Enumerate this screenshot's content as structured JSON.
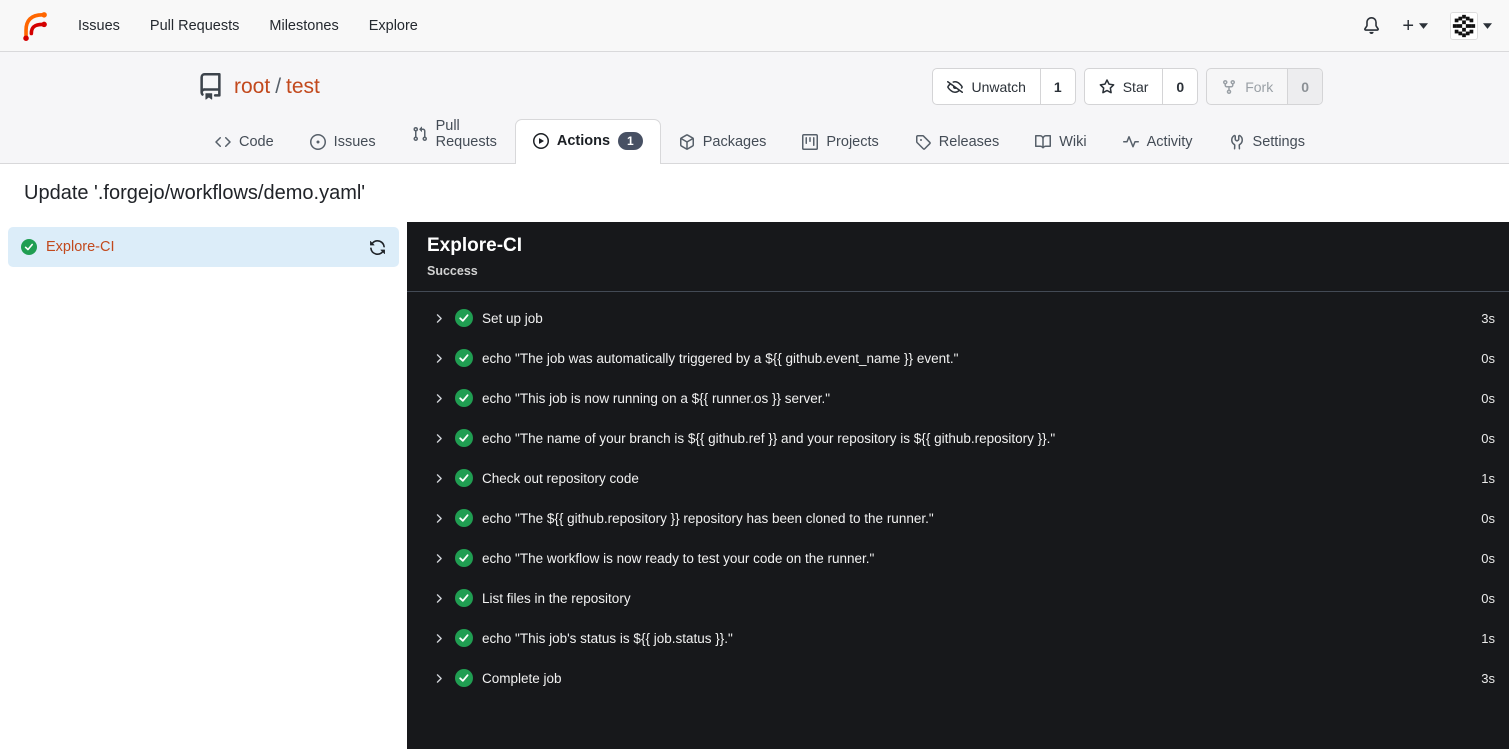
{
  "navbar": {
    "items": [
      {
        "label": "Issues"
      },
      {
        "label": "Pull Requests"
      },
      {
        "label": "Milestones"
      },
      {
        "label": "Explore"
      }
    ],
    "icons": {
      "bell": "notifications",
      "plus": "+",
      "avatar": "user-identicon"
    }
  },
  "repo": {
    "owner": "root",
    "separator": "/",
    "name": "test",
    "actions": [
      {
        "label": "Unwatch",
        "count": "1"
      },
      {
        "label": "Star",
        "count": "0"
      },
      {
        "label": "Fork",
        "count": "0"
      }
    ],
    "tabs": [
      {
        "label": "Code"
      },
      {
        "label": "Issues"
      },
      {
        "label": "Pull Requests"
      },
      {
        "label": "Actions",
        "badge": "1"
      },
      {
        "label": "Packages"
      },
      {
        "label": "Projects"
      },
      {
        "label": "Releases"
      },
      {
        "label": "Wiki"
      },
      {
        "label": "Activity"
      },
      {
        "label": "Settings"
      }
    ]
  },
  "page": {
    "title": "Update '.forgejo/workflows/demo.yaml'"
  },
  "sidebar": {
    "job": {
      "label": "Explore-CI",
      "status": "success"
    }
  },
  "panel": {
    "title": "Explore-CI",
    "status": "Success",
    "steps": [
      {
        "name": "Set up job",
        "duration": "3s"
      },
      {
        "name": "echo \"The job was automatically triggered by a ${{ github.event_name }} event.\"",
        "duration": "0s"
      },
      {
        "name": "echo \"This job is now running on a ${{ runner.os }} server.\"",
        "duration": "0s"
      },
      {
        "name": "echo \"The name of your branch is ${{ github.ref }} and your repository is ${{ github.repository }}.\"",
        "duration": "0s"
      },
      {
        "name": "Check out repository code",
        "duration": "1s"
      },
      {
        "name": "echo \"The ${{ github.repository }} repository has been cloned to the runner.\"",
        "duration": "0s"
      },
      {
        "name": "echo \"The workflow is now ready to test your code on the runner.\"",
        "duration": "0s"
      },
      {
        "name": "List files in the repository",
        "duration": "0s"
      },
      {
        "name": "echo \"This job's status is ${{ job.status }}.\"",
        "duration": "1s"
      },
      {
        "name": "Complete job",
        "duration": "3s"
      }
    ]
  },
  "colors": {
    "accent_link": "#c2491d",
    "success_green": "#209e52",
    "panel_bg": "#17181b",
    "selected_row_blue": "#dcedf9",
    "badge_bg": "#475063"
  }
}
